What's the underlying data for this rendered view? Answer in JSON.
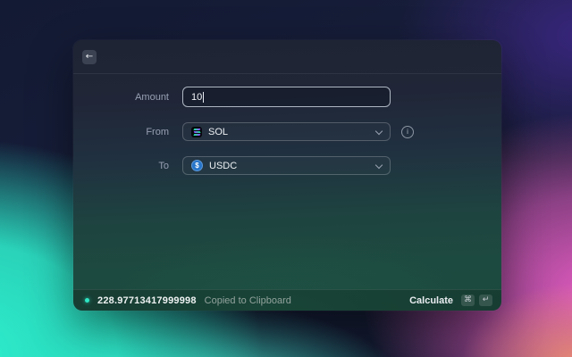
{
  "icons": {
    "back": "←",
    "info": "i",
    "usdc_symbol": "$"
  },
  "form": {
    "amount": {
      "label": "Amount",
      "value": "10"
    },
    "from": {
      "label": "From",
      "value": "SOL"
    },
    "to": {
      "label": "To",
      "value": "USDC"
    }
  },
  "footer": {
    "result": "228.97713417999998",
    "status": "Copied to Clipboard",
    "primary_action": "Calculate",
    "shortcuts": [
      "⌘",
      "↵"
    ]
  },
  "colors": {
    "accent_teal": "#2EE6C4",
    "usdc_blue": "#2775CA",
    "solana_green": "#14F195",
    "solana_purple": "#9945FF",
    "bg_turquoise": "#2DF2CF",
    "bg_magenta": "#EC5FC8",
    "bg_indigo": "#3A2680"
  }
}
